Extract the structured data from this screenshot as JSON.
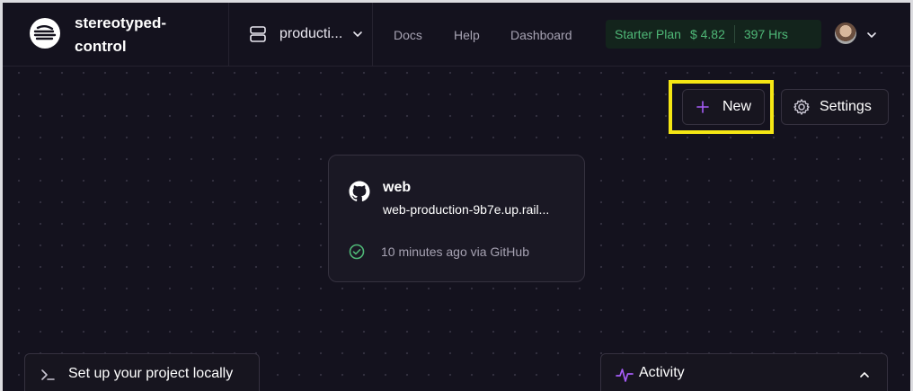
{
  "header": {
    "project_name": "stereotyped-control",
    "environment": "producti...",
    "nav": [
      {
        "label": "Docs"
      },
      {
        "label": "Help"
      },
      {
        "label": "Dashboard"
      }
    ],
    "plan": {
      "name": "Starter Plan",
      "balance": "$ 4.82",
      "hours": "397 Hrs"
    }
  },
  "toolbar": {
    "new_label": "New",
    "settings_label": "Settings"
  },
  "service_card": {
    "name": "web",
    "url": "web-production-9b7e.up.rail...",
    "status": "10 minutes ago via GitHub"
  },
  "bottom": {
    "setup_label": "Set up your project locally",
    "activity_label": "Activity"
  },
  "colors": {
    "background": "#14121e",
    "accent": "#a55cf6",
    "success": "#4fb877",
    "highlight": "#f5e614"
  }
}
